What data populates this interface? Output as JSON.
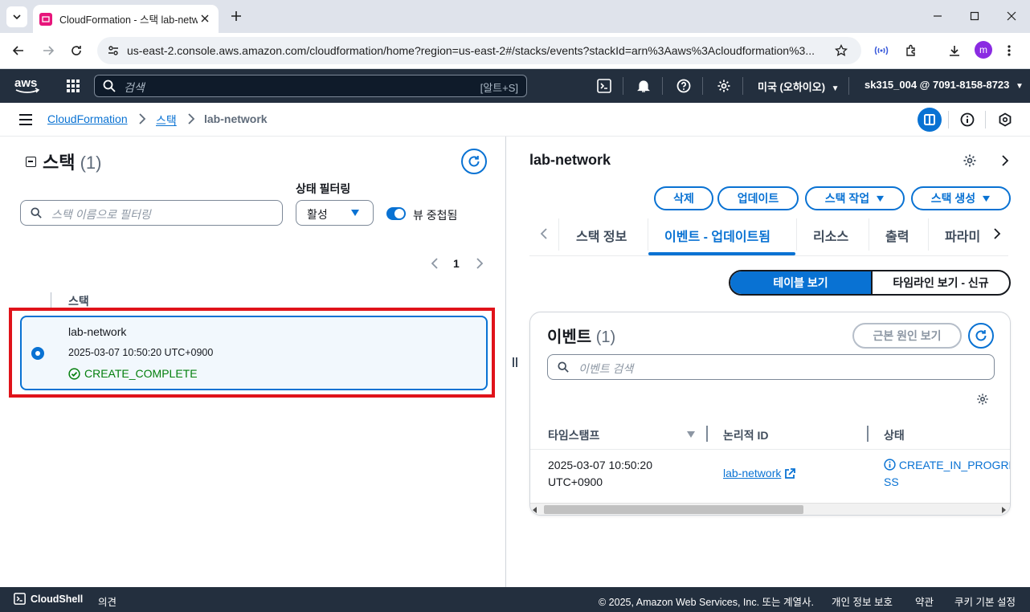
{
  "browser": {
    "tab_title": "CloudFormation - 스택 lab-network",
    "url": "us-east-2.console.aws.amazon.com/cloudformation/home?region=us-east-2#/stacks/events?stackId=arn%3Aaws%3Acloudformation%3...",
    "profile_initial": "m"
  },
  "aws_nav": {
    "search_placeholder": "검색",
    "search_shortcut": "[알트+S]",
    "region": "미국 (오하이오)",
    "account": "sk315_004 @ 7091-8158-8723"
  },
  "breadcrumb": {
    "root": "CloudFormation",
    "stacks": "스택",
    "current": "lab-network"
  },
  "left_panel": {
    "title": "스택",
    "count": "(1)",
    "filter_placeholder": "스택 이름으로 필터링",
    "status_filter_label": "상태 필터링",
    "status_filter_value": "활성",
    "nested_toggle_label": "뷰 중첩됨",
    "nested_toggle_on": true,
    "page": "1",
    "column_header": "스택",
    "stacks": [
      {
        "name": "lab-network",
        "created": "2025-03-07 10:50:20 UTC+0900",
        "status": "CREATE_COMPLETE",
        "selected": true
      }
    ]
  },
  "right_panel": {
    "title": "lab-network",
    "actions": {
      "delete": "삭제",
      "update": "업데이트",
      "stack_actions": "스택 작업",
      "create_stack": "스택 생성"
    },
    "tabs": [
      "스택 정보",
      "이벤트 - 업데이트됨",
      "리소스",
      "출력",
      "파라미"
    ],
    "active_tab": 1,
    "view_toggle": {
      "table": "테이블 보기",
      "timeline": "타임라인 보기 - 신규",
      "active": "table"
    },
    "events": {
      "title": "이벤트",
      "count": "(1)",
      "root_cause_button": "근본 원인 보기",
      "search_placeholder": "이벤트 검색",
      "columns": [
        "타임스탬프",
        "논리적 ID",
        "상태"
      ],
      "rows": [
        {
          "timestamp_line1": "2025-03-07 10:50:20",
          "timestamp_line2": "UTC+0900",
          "logical_id": "lab-network",
          "status": "CREATE_IN_PROGRESS"
        }
      ]
    }
  },
  "footer": {
    "cloudshell": "CloudShell",
    "feedback": "의견",
    "copyright": "© 2025, Amazon Web Services, Inc. 또는 계열사.",
    "privacy": "개인 정보 보호",
    "terms": "약관",
    "cookies": "쿠키 기본 설정"
  },
  "colors": {
    "aws_nav_bg": "#232f3e",
    "link_blue": "#0972d3",
    "success_green": "#037f0c",
    "highlight_red": "#e0131a"
  }
}
